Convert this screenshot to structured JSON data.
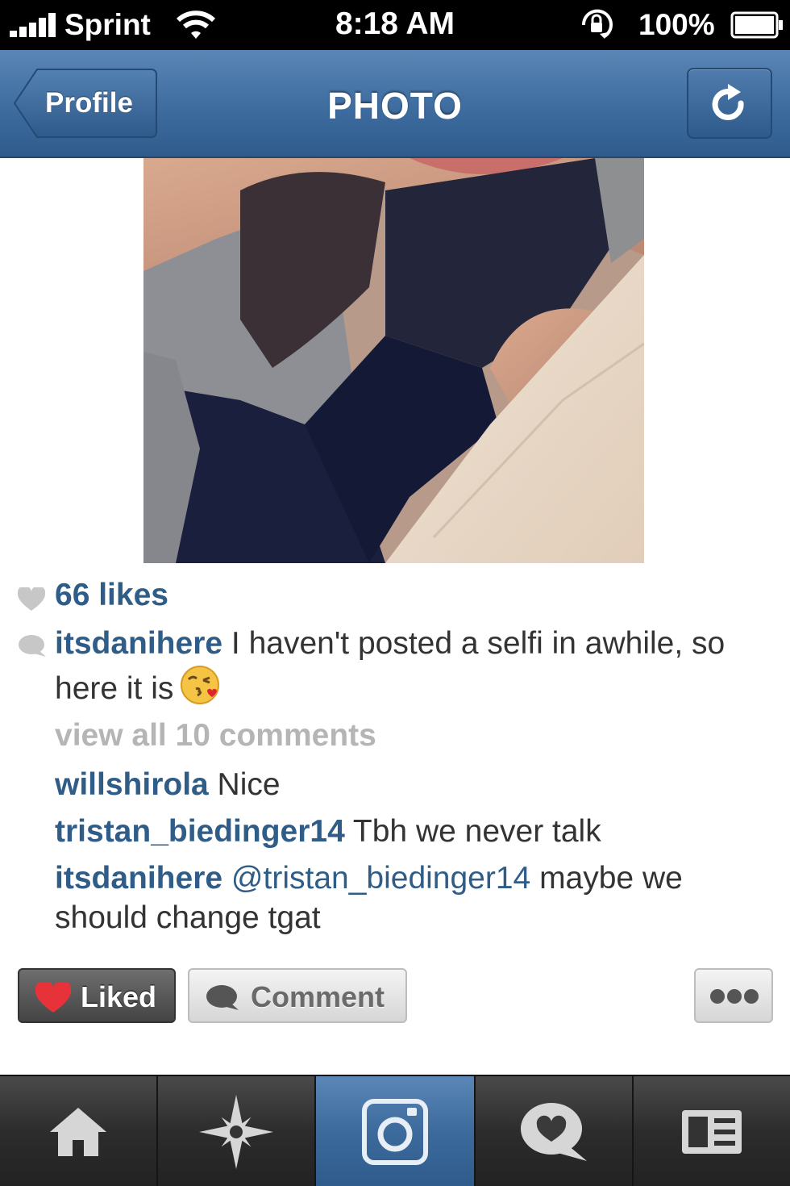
{
  "status_bar": {
    "carrier": "Sprint",
    "time": "8:18 AM",
    "battery_percent": "100%",
    "signal_icon": "signal-bars-icon",
    "wifi_icon": "wifi-icon",
    "lock_icon": "rotation-lock-icon",
    "battery_icon": "battery-full-icon"
  },
  "nav": {
    "back_label": "Profile",
    "title": "PHOTO",
    "refresh_icon": "refresh-icon"
  },
  "post": {
    "likes": "66 likes",
    "caption_user": "itsdanihere",
    "caption_text": " I haven't posted a selfi in awhile, so here it is",
    "caption_emoji": "kissing-face-emoji",
    "view_all": "view all 10 comments",
    "comments": [
      {
        "user": "willshirola",
        "text": " Nice"
      },
      {
        "user": "tristan_biedinger14",
        "text": " Tbh we never talk"
      },
      {
        "user": "itsdanihere",
        "mention": " @tristan_biedinger14",
        "text": " maybe we should change tgat"
      }
    ]
  },
  "actions": {
    "liked_label": "Liked",
    "comment_label": "Comment",
    "more_icon": "more-dots-icon"
  },
  "tabs": [
    {
      "icon": "home-icon",
      "active": false
    },
    {
      "icon": "explore-star-icon",
      "active": false
    },
    {
      "icon": "camera-icon",
      "active": true
    },
    {
      "icon": "activity-heart-bubble-icon",
      "active": false
    },
    {
      "icon": "profile-card-icon",
      "active": false
    }
  ],
  "colors": {
    "nav_blue": "#3e6c9f",
    "username_blue": "#2f5d87",
    "liked_red": "#e8323a"
  }
}
